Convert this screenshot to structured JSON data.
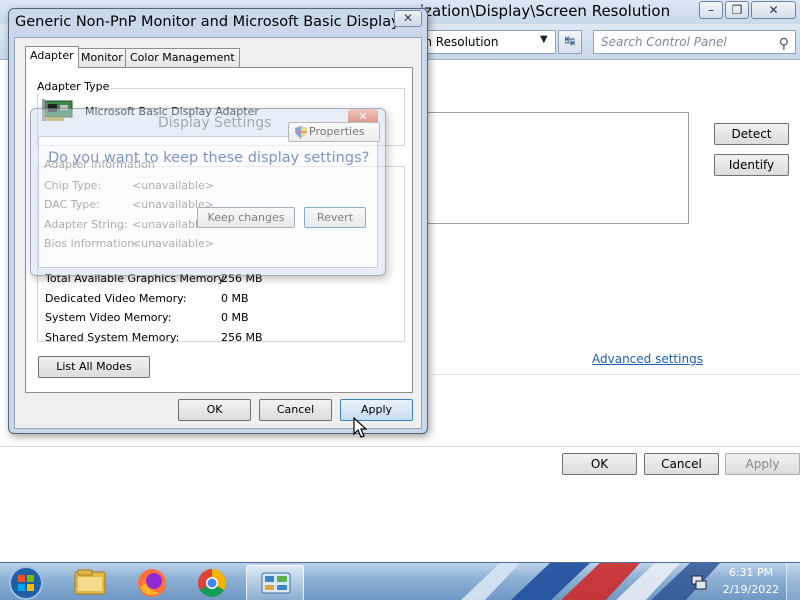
{
  "control_panel": {
    "title": "ization\\Display\\Screen Resolution",
    "address_text": "en Resolution",
    "search_placeholder": "Search Control Panel",
    "detect_label": "Detect",
    "identify_label": "Identify",
    "advanced_link": "Advanced settings",
    "ok_label": "OK",
    "cancel_label": "Cancel",
    "apply_label": "Apply"
  },
  "properties_dialog": {
    "title": "Generic Non-PnP Monitor and Microsoft Basic Display ...",
    "tabs": [
      "Adapter",
      "Monitor",
      "Color Management"
    ],
    "adapter_type_label": "Adapter Type",
    "adapter_name": "Microsoft Basic Display Adapter",
    "memory": [
      {
        "label": "Total Available Graphics Memory:",
        "value": "256 MB"
      },
      {
        "label": "Dedicated Video Memory:",
        "value": "0 MB"
      },
      {
        "label": "System Video Memory:",
        "value": "0 MB"
      },
      {
        "label": "Shared System Memory:",
        "value": "256 MB"
      }
    ],
    "list_modes_label": "List All Modes",
    "ok_label": "OK",
    "cancel_label": "Cancel",
    "apply_label": "Apply"
  },
  "confirm_dialog": {
    "title": "Display Settings",
    "question": "Do you want to keep these display settings?",
    "keep_label": "Keep changes",
    "revert_label": "Revert",
    "properties_label": "Properties",
    "adapter_info_label": "Adapter Information",
    "info": [
      {
        "label": "Chip Type:",
        "value": "<unavailable>"
      },
      {
        "label": "DAC Type:",
        "value": "<unavailable>"
      },
      {
        "label": "Adapter String:",
        "value": "<unavailable>"
      },
      {
        "label": "Bios Information:",
        "value": "<unavailable>"
      }
    ]
  },
  "taskbar": {
    "time": "6:31 PM",
    "date": "2/19/2022",
    "icons": [
      "windows-start-icon",
      "file-explorer-icon",
      "firefox-icon",
      "chrome-icon",
      "control-panel-icon",
      "network-icon"
    ]
  }
}
